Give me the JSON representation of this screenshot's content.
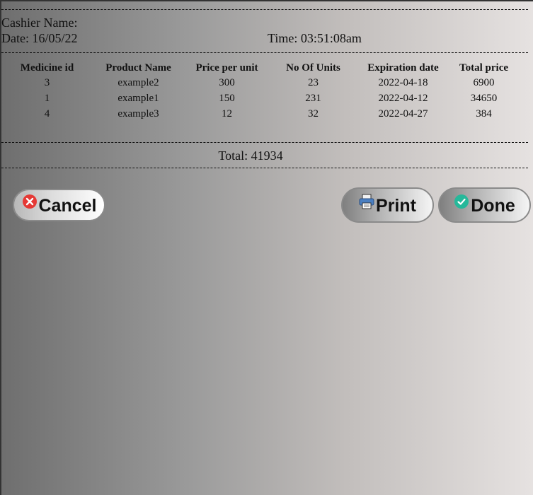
{
  "receipt": {
    "cashier_label": "Cashier Name:",
    "date_label": "Date: 16/05/22",
    "time_label": "Time: 03:51:08am",
    "columns": [
      "Medicine id",
      "Product Name",
      "Price per unit",
      "No Of Units",
      "Expiration date",
      "Total price"
    ],
    "rows": [
      [
        "3",
        "example2",
        "300",
        "23",
        "2022-04-18",
        "6900"
      ],
      [
        "1",
        "example1",
        "150",
        "231",
        "2022-04-12",
        "34650"
      ],
      [
        "4",
        "example3",
        "12",
        "32",
        "2022-04-27",
        "384"
      ]
    ],
    "total_label": "Total: 41934"
  },
  "buttons": {
    "cancel_label": "Cancel",
    "print_label": "Print",
    "done_label": "Done"
  },
  "icons": {
    "cancel": "close-circle-icon",
    "print": "printer-icon",
    "done": "check-circle-icon"
  },
  "colors": {
    "cancel_icon": "#e53935",
    "done_icon": "#26b89a",
    "print_icon": "#4a7fc1"
  }
}
